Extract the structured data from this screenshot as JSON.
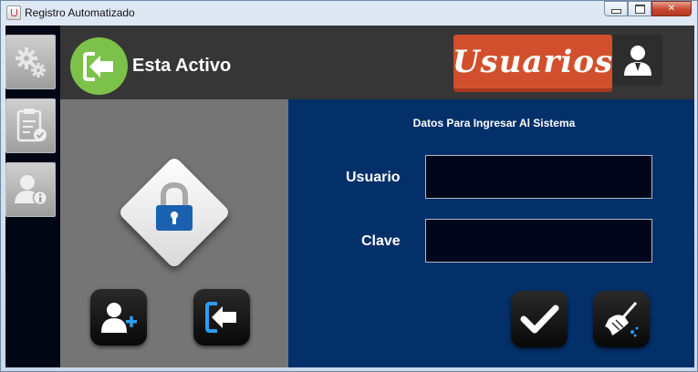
{
  "window": {
    "title": "Registro Automatizado",
    "minimize_label": "",
    "maximize_label": "",
    "close_label": "✕"
  },
  "sidebar": {
    "items": [
      {
        "name": "settings",
        "icon": "gears-icon"
      },
      {
        "name": "report",
        "icon": "clipboard-check-icon"
      },
      {
        "name": "user-info",
        "icon": "user-info-icon"
      }
    ]
  },
  "header": {
    "status_label": "Esta Activo",
    "banner_label": "Usuarios",
    "status_icon": "logout-arrow-icon",
    "badge_icon": "user-suit-icon"
  },
  "login": {
    "title": "Datos Para Ingresar Al Sistema",
    "username_label": "Usuario",
    "username_value": "",
    "password_label": "Clave",
    "password_value": ""
  },
  "actions": {
    "add_user_icon": "add-user-icon",
    "logout_icon": "logout-arrow-icon",
    "confirm_icon": "checkmark-icon",
    "clear_icon": "broom-icon"
  },
  "colors": {
    "status_green": "#7cc24a",
    "banner_orange": "#d14f2d",
    "form_blue": "#04306a",
    "lock_blue": "#1a62b0"
  }
}
